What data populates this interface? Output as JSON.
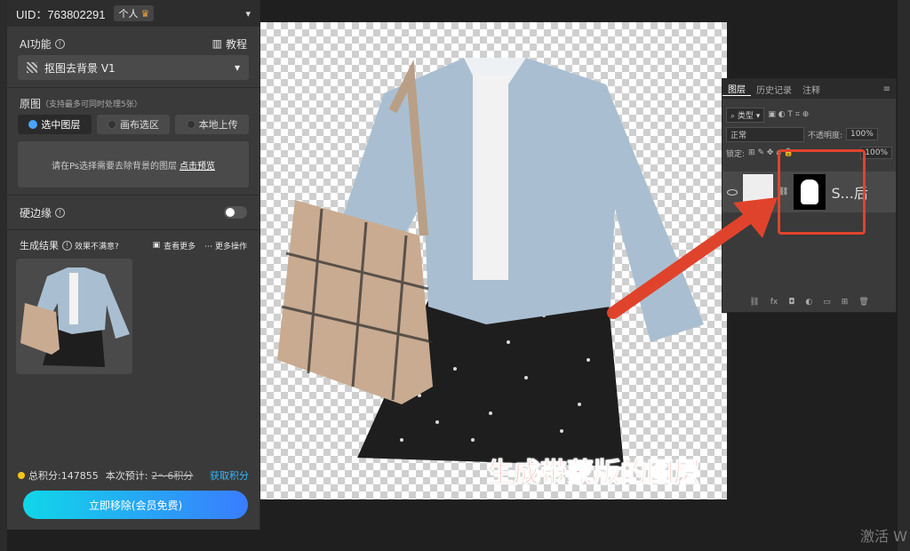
{
  "plugin": {
    "uid": "UID：763802291",
    "account_type": "个人",
    "ai_label": "AI功能",
    "tutorial": "教程",
    "function_select": "抠图去背景 V1",
    "source_label": "原图",
    "source_hint": "（支持最多可同时处理5张）",
    "source_tabs": [
      "选中图层",
      "画布选区",
      "本地上传"
    ],
    "select_hint": "请在Ps选择需要去除背景的图层",
    "select_link": "点击预览",
    "hard_edge": "硬边缘",
    "result_label": "生成结果",
    "result_unsatisfied": "效果不满意?",
    "view_more": "查看更多",
    "more_ops": "更多操作",
    "total_points": "总积分:147855",
    "estimate_label": "本次预计:",
    "estimate_value": "2～6积分",
    "get_points": "获取积分",
    "cta": "立即移除(会员免费)"
  },
  "layers": {
    "tabs": [
      "图层",
      "历史记录",
      "注释"
    ],
    "filter": "类型",
    "blend": "正常",
    "opacity_label": "不透明度:",
    "opacity": "100%",
    "lock_label": "锁定:",
    "fill": "100%",
    "layer_name": "S...后"
  },
  "caption": "生成带蒙版的图层",
  "watermark": "激活 W"
}
